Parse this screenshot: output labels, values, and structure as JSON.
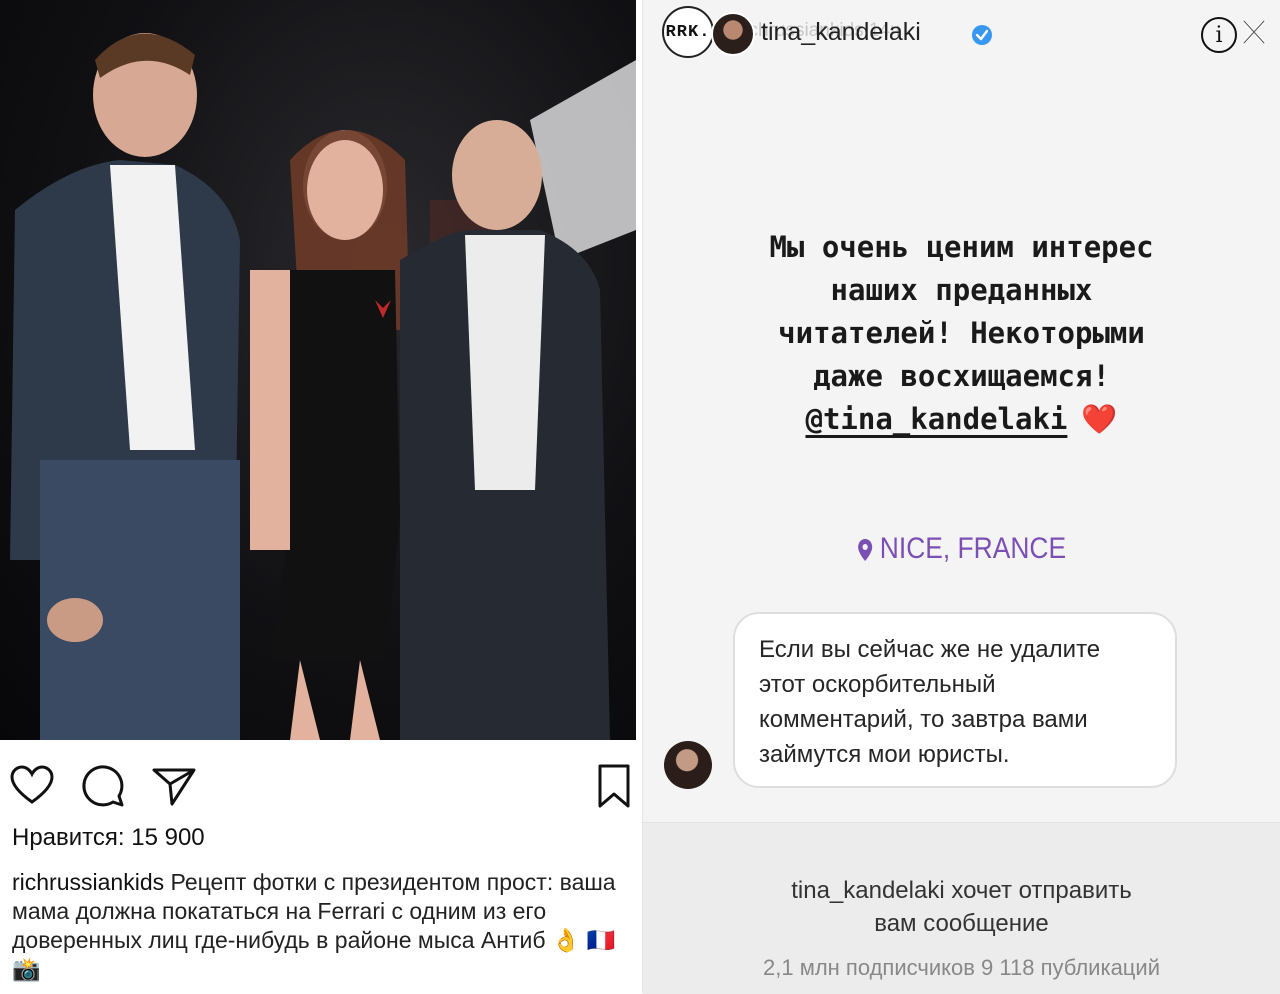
{
  "post": {
    "likes_label": "Нравится: 15 900",
    "username": "richrussiankids",
    "caption": "Рецепт фотки с президентом прост: ваша мама должна покататься на Ferrari с одним из его доверенных лиц где-нибудь в районе мыса Антиб 👌 🇫🇷 📸",
    "icons": [
      "heart-icon",
      "comment-icon",
      "share-icon",
      "bookmark-icon"
    ]
  },
  "story": {
    "rrk_label": "RRK.",
    "ghost_username": "richrussiankids 14ч",
    "username": "tina_kandelaki",
    "info_label": "i",
    "text_lines": [
      "Мы очень ценим интерес",
      "наших преданных",
      "читателей! Некоторыми",
      "даже восхищаемся!"
    ],
    "mention": "@tina_kandelaki",
    "heart": "❤️",
    "location": "NICE, FRANCE",
    "message": "Если вы сейчас же не удалите этот оскорбительный комментарий, то завтра вами займутся мои юристы.",
    "notice_line1": "tina_kandelaki хочет отправить",
    "notice_line2": "вам сообщение",
    "notice_stats": "2,1 млн подписчиков 9 118 публикаций"
  },
  "colors": {
    "location_purple": "#7b4fb3",
    "heart_red": "#e0282f",
    "verified_blue": "#3897f0"
  }
}
